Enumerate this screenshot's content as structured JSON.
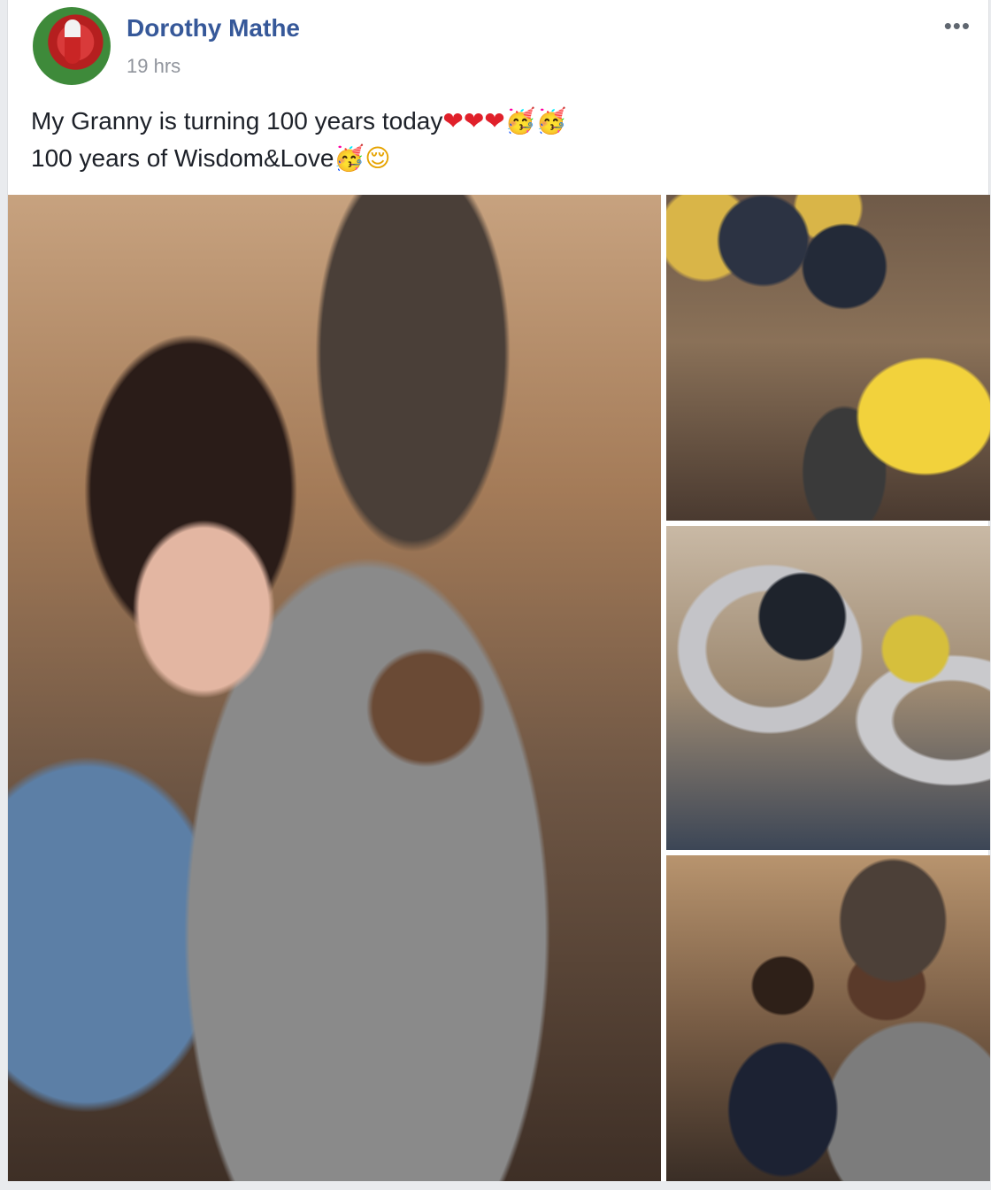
{
  "post": {
    "author": "Dorothy Mathe",
    "time": "19 hrs",
    "more_label": "•••",
    "text_line1": "My Granny is turning 100 years today",
    "text_line2": "100 years of Wisdom&Love",
    "emoji_heart": "❤",
    "emoji_party": "🥳",
    "emoji_smile": "😌"
  },
  "colors": {
    "author_link": "#365899",
    "timestamp": "#90949c",
    "text": "#1d2129",
    "background": "#e9ebee"
  },
  "icons": [
    "avatar-photo",
    "more-options-icon",
    "heart-emoji-icon",
    "party-face-emoji-icon",
    "relieved-face-emoji-icon"
  ]
}
